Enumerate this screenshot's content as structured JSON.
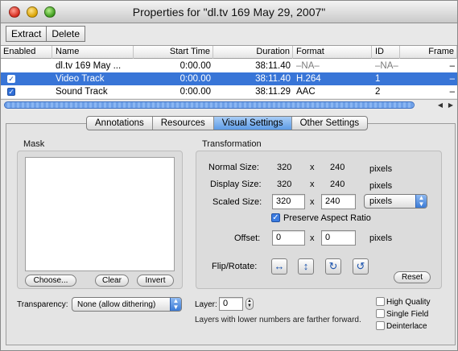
{
  "window": {
    "title": "Properties for \"dl.tv 169 May 29, 2007\""
  },
  "toolbar": {
    "extract_label": "Extract",
    "delete_label": "Delete"
  },
  "table": {
    "headers": [
      "Enabled",
      "Name",
      "Start Time",
      "Duration",
      "Format",
      "ID",
      "Frame"
    ],
    "rows": [
      {
        "enabled": false,
        "name": "dl.tv 169 May ...",
        "start": "0:00.00",
        "duration": "38:11.40",
        "format": "–NA–",
        "id": "–NA–",
        "frame": "–",
        "selected": false
      },
      {
        "enabled": true,
        "name": "Video Track",
        "start": "0:00.00",
        "duration": "38:11.40",
        "format": "H.264",
        "id": "1",
        "frame": "–",
        "selected": true
      },
      {
        "enabled": true,
        "name": "Sound Track",
        "start": "0:00.00",
        "duration": "38:11.29",
        "format": "AAC",
        "id": "2",
        "frame": "–",
        "selected": false
      }
    ]
  },
  "tabs": [
    {
      "label": "Annotations",
      "active": false
    },
    {
      "label": "Resources",
      "active": false
    },
    {
      "label": "Visual Settings",
      "active": true
    },
    {
      "label": "Other Settings",
      "active": false
    }
  ],
  "mask": {
    "title": "Mask",
    "choose_label": "Choose...",
    "clear_label": "Clear",
    "invert_label": "Invert"
  },
  "transformation": {
    "title": "Transformation",
    "normal_size_label": "Normal Size:",
    "normal_w": "320",
    "normal_h": "240",
    "display_size_label": "Display Size:",
    "display_w": "320",
    "display_h": "240",
    "scaled_size_label": "Scaled Size:",
    "scaled_w": "320",
    "scaled_h": "240",
    "units_option": "pixels",
    "pixels_text": "pixels",
    "times": "x",
    "preserve_aspect_label": "Preserve Aspect Ratio",
    "preserve_aspect_checked": true,
    "offset_label": "Offset:",
    "offset_x": "0",
    "offset_y": "0",
    "flip_rotate_label": "Flip/Rotate:",
    "reset_label": "Reset"
  },
  "transparency": {
    "label": "Transparency:",
    "value": "None (allow dithering)"
  },
  "layer": {
    "label": "Layer:",
    "value": "0",
    "note": "Layers with lower numbers are farther forward."
  },
  "options": {
    "high_quality": "High Quality",
    "single_field": "Single Field",
    "deinterlace": "Deinterlace"
  },
  "icons": {
    "flip_horizontal": "flip-horizontal-icon",
    "flip_vertical": "flip-vertical-icon",
    "rotate_right": "rotate-clockwise-icon",
    "rotate_left": "rotate-counterclockwise-icon"
  },
  "colors": {
    "selection": "#3875d7",
    "active_tab": "#5d9be6"
  }
}
